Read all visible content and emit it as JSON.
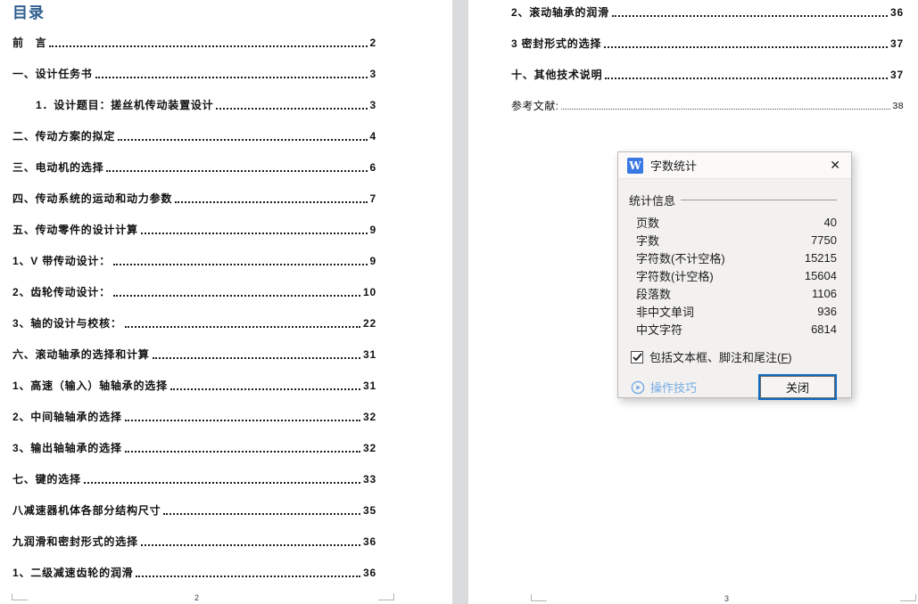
{
  "left_page": {
    "title": "目录",
    "footer_page_number": "2",
    "entries": [
      {
        "label": "前　言",
        "page": "2"
      },
      {
        "label": "一、设计任务书",
        "page": "3"
      },
      {
        "label": "1．设计题目：搓丝机传动装置设计",
        "page": "3",
        "indent": true
      },
      {
        "label": "二、传动方案的拟定",
        "page": "4"
      },
      {
        "label": "三、电动机的选择",
        "page": "6"
      },
      {
        "label": "四、传动系统的运动和动力参数",
        "page": "7"
      },
      {
        "label": "五、传动零件的设计计算",
        "page": "9"
      },
      {
        "label": "1、V 带传动设计：",
        "page": "9"
      },
      {
        "label": "2、齿轮传动设计：",
        "page": "10"
      },
      {
        "label": "3、轴的设计与校核：",
        "page": "22"
      },
      {
        "label": "六、滚动轴承的选择和计算",
        "page": "31"
      },
      {
        "label": "1、高速（输入）轴轴承的选择",
        "page": "31"
      },
      {
        "label": "2、中间轴轴承的选择",
        "page": "32"
      },
      {
        "label": "3、输出轴轴承的选择",
        "page": "32"
      },
      {
        "label": "七、键的选择",
        "page": "33"
      },
      {
        "label": "八减速器机体各部分结构尺寸",
        "page": "35"
      },
      {
        "label": "九润滑和密封形式的选择",
        "page": "36"
      },
      {
        "label": "1、二级减速齿轮的润滑",
        "page": "36"
      }
    ]
  },
  "right_page": {
    "footer_page_number": "3",
    "entries": [
      {
        "label": "2、滚动轴承的润滑",
        "page": "36"
      },
      {
        "label": "3 密封形式的选择",
        "page": "37"
      },
      {
        "label": "十、其他技术说明",
        "page": "37"
      },
      {
        "label": "参考文献:",
        "page": "38",
        "plain": true
      }
    ]
  },
  "dialog": {
    "title": "字数统计",
    "app_icon_glyph": "W",
    "close_glyph": "✕",
    "section_label": "统计信息",
    "stats": [
      {
        "label": "页数",
        "value": "40"
      },
      {
        "label": "字数",
        "value": "7750"
      },
      {
        "label": "字符数(不计空格)",
        "value": "15215"
      },
      {
        "label": "字符数(计空格)",
        "value": "15604"
      },
      {
        "label": "段落数",
        "value": "1106"
      },
      {
        "label": "非中文单词",
        "value": "936"
      },
      {
        "label": "中文字符",
        "value": "6814"
      }
    ],
    "checkbox": {
      "checked": true,
      "label_pre": "包括文本框、脚注和尾注(",
      "accel_key": "F",
      "label_post": ")"
    },
    "tips_link_label": "操作技巧",
    "close_button_label": "关闭"
  },
  "colors": {
    "heading_blue": "#2f5e8e",
    "wps_icon_blue": "#3a78e3",
    "link_blue": "#74ace6",
    "button_focus_blue": "#0f6cbe",
    "dialog_bg": "#f2f1ef",
    "page_gap_gray": "#d9dbdd"
  }
}
